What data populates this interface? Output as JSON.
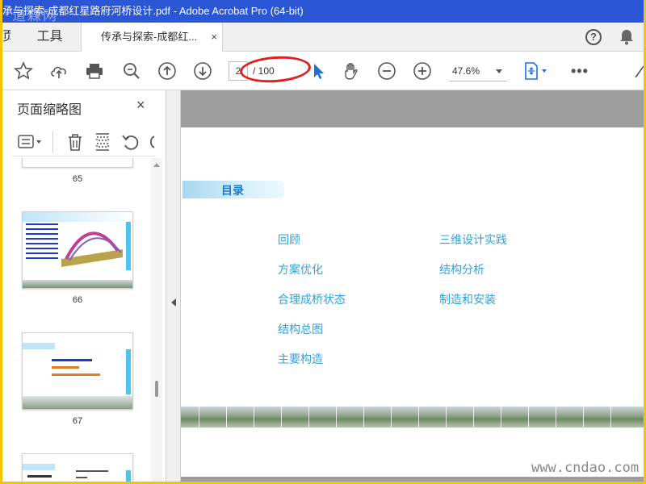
{
  "window": {
    "title": "承与探索-成都红星路府河桥设计.pdf - Adobe Acrobat Pro (64-bit)",
    "watermark_top": "道森网"
  },
  "tabs": {
    "home": "页",
    "tools": "工具",
    "document": "传承与探索-成都红...",
    "close": "×"
  },
  "toolbar": {
    "page_current": "2",
    "page_total": "/ 100",
    "zoom": "47.6%",
    "more": "•••",
    "help": "?"
  },
  "panel": {
    "title": "页面缩略图",
    "close": "×",
    "thumbnails": [
      {
        "label": "65"
      },
      {
        "label": "66"
      },
      {
        "label": "67"
      }
    ]
  },
  "document": {
    "toc_title": "目录",
    "toc_left": [
      "回顾",
      "方案优化",
      "合理成桥状态",
      "结构总图",
      "主要构造"
    ],
    "toc_right": [
      "三维设计实践",
      "结构分析",
      "制造和安装"
    ]
  },
  "footer": {
    "watermark": "www.cndao.com"
  },
  "colors": {
    "title_bar": "#2b56d6",
    "toc_text": "#2fa2dd",
    "toc_heading": "#1a7ad0",
    "highlight_circle": "#e02020",
    "frame_border": "#f5c400"
  }
}
